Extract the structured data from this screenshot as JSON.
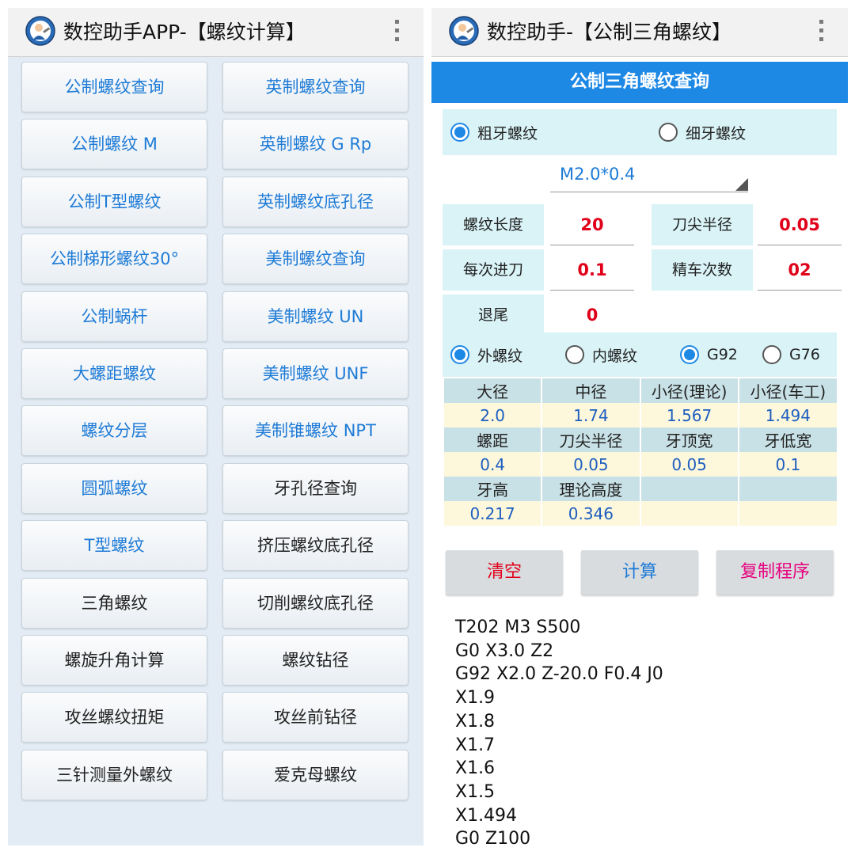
{
  "left": {
    "title": "数控助手APP-【螺纹计算】",
    "buttons": [
      {
        "label": "公制螺纹查询",
        "color": "#1e7bd6"
      },
      {
        "label": "英制螺纹查询",
        "color": "#1e7bd6"
      },
      {
        "label": "公制螺纹 M",
        "color": "#1e7bd6"
      },
      {
        "label": "英制螺纹 G Rp",
        "color": "#1e7bd6"
      },
      {
        "label": "公制T型螺纹",
        "color": "#1e7bd6"
      },
      {
        "label": "英制螺纹底孔径",
        "color": "#1e7bd6"
      },
      {
        "label": "公制梯形螺纹30°",
        "color": "#1e7bd6"
      },
      {
        "label": "美制螺纹查询",
        "color": "#1e7bd6"
      },
      {
        "label": "公制蜗杆",
        "color": "#1e7bd6"
      },
      {
        "label": "美制螺纹 UN",
        "color": "#1e7bd6"
      },
      {
        "label": "大螺距螺纹",
        "color": "#1e7bd6"
      },
      {
        "label": "美制螺纹 UNF",
        "color": "#1e7bd6"
      },
      {
        "label": "螺纹分层",
        "color": "#1e7bd6"
      },
      {
        "label": "美制锥螺纹 NPT",
        "color": "#1e7bd6"
      },
      {
        "label": "圆弧螺纹",
        "color": "#1e7bd6"
      },
      {
        "label": "牙孔径查询",
        "color": "#222222"
      },
      {
        "label": "T型螺纹",
        "color": "#1e7bd6"
      },
      {
        "label": "挤压螺纹底孔径",
        "color": "#222222"
      },
      {
        "label": "三角螺纹",
        "color": "#222222"
      },
      {
        "label": "切削螺纹底孔径",
        "color": "#222222"
      },
      {
        "label": "螺旋升角计算",
        "color": "#222222"
      },
      {
        "label": "螺纹钻径",
        "color": "#222222"
      },
      {
        "label": "攻丝螺纹扭矩",
        "color": "#222222"
      },
      {
        "label": "攻丝前钻径",
        "color": "#222222"
      },
      {
        "label": "三针测量外螺纹",
        "color": "#222222"
      },
      {
        "label": "爱克母螺纹",
        "color": "#222222"
      }
    ]
  },
  "right": {
    "title": "数控助手-【公制三角螺纹】",
    "header": "公制三角螺纹查询",
    "pitch_type": {
      "coarse": "粗牙螺纹",
      "fine": "细牙螺纹",
      "selected": "coarse"
    },
    "spec": "M2.0*0.4",
    "params": {
      "length_label": "螺纹长度",
      "length": "20",
      "nose_radius_label": "刀尖半径",
      "nose_radius": "0.05",
      "feed_label": "每次进刀",
      "feed": "0.1",
      "finish_label": "精车次数",
      "finish": "02",
      "retract_label": "退尾",
      "retract": "0"
    },
    "mode": {
      "external": "外螺纹",
      "internal": "内螺纹",
      "g92": "G92",
      "g76": "G76",
      "thread_selected": "external",
      "cycle_selected": "g92"
    },
    "results": {
      "row1_labels": [
        "大径",
        "中径",
        "小径(理论)",
        "小径(车工)"
      ],
      "row1_values": [
        "2.0",
        "1.74",
        "1.567",
        "1.494"
      ],
      "row2_labels": [
        "螺距",
        "刀尖半径",
        "牙顶宽",
        "牙低宽"
      ],
      "row2_values": [
        "0.4",
        "0.05",
        "0.05",
        "0.1"
      ],
      "row3_labels": [
        "牙高",
        "理论高度",
        "",
        ""
      ],
      "row3_values": [
        "0.217",
        "0.346",
        "",
        ""
      ]
    },
    "actions": {
      "clear": "清空",
      "calc": "计算",
      "copy": "复制程序",
      "clear_color": "#e0001a",
      "calc_color": "#1e7bd6",
      "copy_color": "#e6007e"
    },
    "gcode": [
      "T202 M3 S500",
      "G0 X3.0 Z2",
      "G92 X2.0 Z-20.0 F0.4 J0",
      "X1.9",
      "X1.8",
      "X1.7",
      "X1.6",
      "X1.5",
      "X1.494",
      "G0 Z100"
    ]
  }
}
